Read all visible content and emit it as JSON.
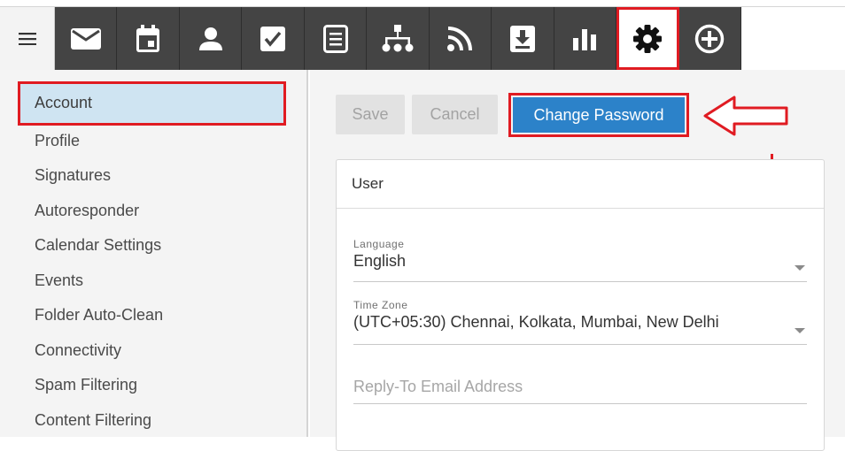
{
  "toolbar": {
    "menu_icon": "hamburger-icon",
    "icons": [
      "mail-icon",
      "calendar-icon",
      "contact-icon",
      "tasks-icon",
      "notes-icon",
      "sitemap-icon",
      "rss-icon",
      "download-icon",
      "chart-icon",
      "gear-icon",
      "add-circle-icon"
    ],
    "active_icon": "gear-icon"
  },
  "sidebar": {
    "items": [
      {
        "label": "Account"
      },
      {
        "label": "Profile"
      },
      {
        "label": "Signatures"
      },
      {
        "label": "Autoresponder"
      },
      {
        "label": "Calendar Settings"
      },
      {
        "label": "Events"
      },
      {
        "label": "Folder Auto-Clean"
      },
      {
        "label": "Connectivity"
      },
      {
        "label": "Spam Filtering"
      },
      {
        "label": "Content Filtering"
      }
    ],
    "active_index": 0
  },
  "actions": {
    "save_label": "Save",
    "cancel_label": "Cancel",
    "change_password_label": "Change Password"
  },
  "card": {
    "title": "User",
    "language": {
      "label": "Language",
      "value": "English"
    },
    "timezone": {
      "label": "Time Zone",
      "value": "(UTC+05:30) Chennai, Kolkata, Mumbai, New Delhi"
    },
    "reply_to": {
      "placeholder": "Reply-To Email Address"
    }
  },
  "colors": {
    "toolbar_bg": "#444444",
    "highlight_red": "#e01b22",
    "primary_blue": "#2c82c9",
    "active_nav_bg": "#cfe4f2"
  }
}
